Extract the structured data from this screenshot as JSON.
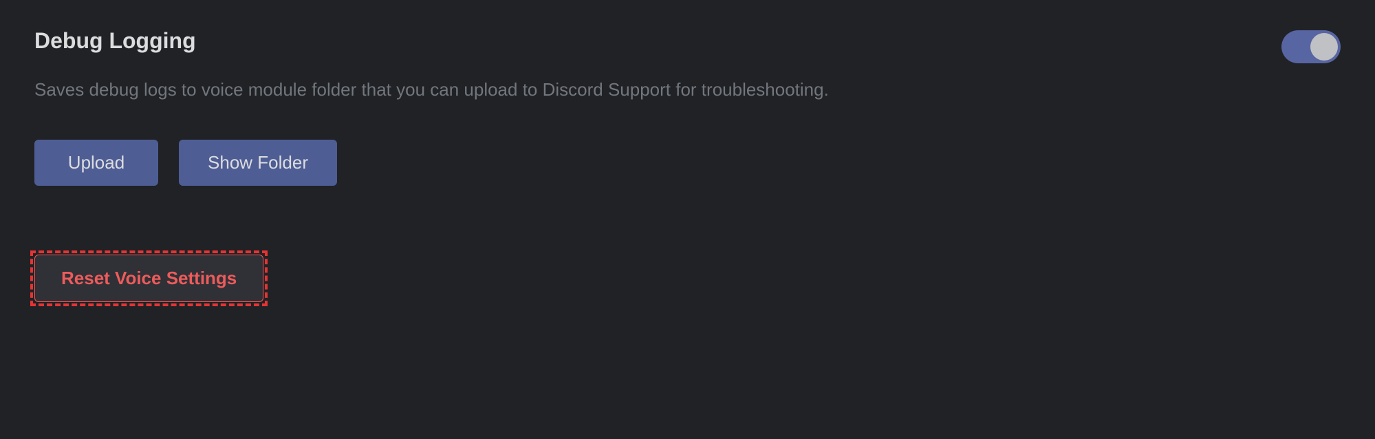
{
  "section": {
    "title": "Debug Logging",
    "description": "Saves debug logs to voice module folder that you can upload to Discord Support for troubleshooting."
  },
  "toggle": {
    "state": "on"
  },
  "buttons": {
    "upload": "Upload",
    "show_folder": "Show Folder",
    "reset": "Reset Voice Settings"
  }
}
